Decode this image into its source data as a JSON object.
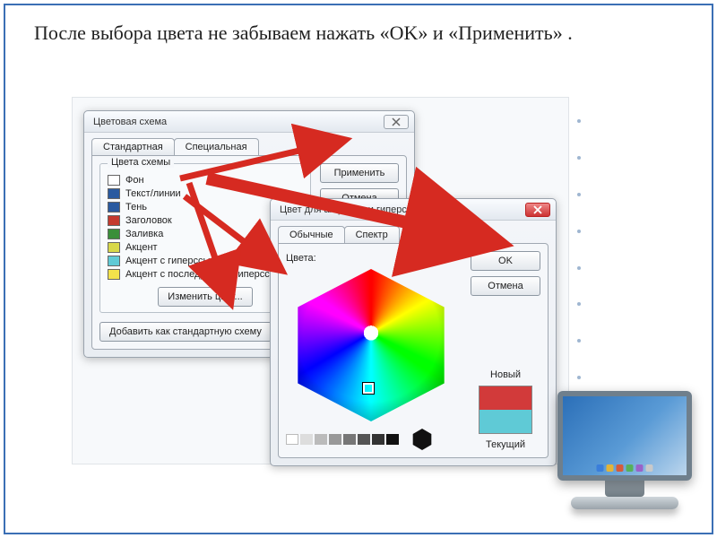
{
  "caption": "После выбора цвета не забываем нажать  «OK»  и «Применить» .",
  "scheme_dialog": {
    "title": "Цветовая схема",
    "tabs": {
      "standard": "Стандартная",
      "special": "Специальная"
    },
    "group_title": "Цвета схемы",
    "items": [
      {
        "label": "Фон",
        "c": "#ffffff"
      },
      {
        "label": "Текст/линии",
        "c": "#2a5aa0"
      },
      {
        "label": "Тень",
        "c": "#2a5aa0"
      },
      {
        "label": "Заголовок",
        "c": "#c43a2f"
      },
      {
        "label": "Заливка",
        "c": "#3a8f3a"
      },
      {
        "label": "Акцент",
        "c": "#d8d84a"
      },
      {
        "label": "Акцент с гиперссылкой",
        "c": "#5fcad6"
      },
      {
        "label": "Акцент с последующей гиперссылкой",
        "c": "#f3e24b"
      }
    ],
    "change_color": "Изменить цвет...",
    "add_scheme": "Добавить как стандартную схему",
    "apply": "Применить",
    "cancel": "Отмена"
  },
  "color_dialog": {
    "title": "Цвет для акцентов и гиперссылок",
    "tabs": {
      "basic": "Обычные",
      "spectrum": "Спектр"
    },
    "colors_label": "Цвета:",
    "ok": "OK",
    "cancel": "Отмена",
    "new": "Новый",
    "current": "Текущий",
    "new_c": "#d23a3a",
    "current_c": "#5fcad6"
  },
  "dock_icons": [
    "#3a7edb",
    "#e3b438",
    "#d65a3a",
    "#57b05a",
    "#9a62c9",
    "#c9c9c9"
  ]
}
